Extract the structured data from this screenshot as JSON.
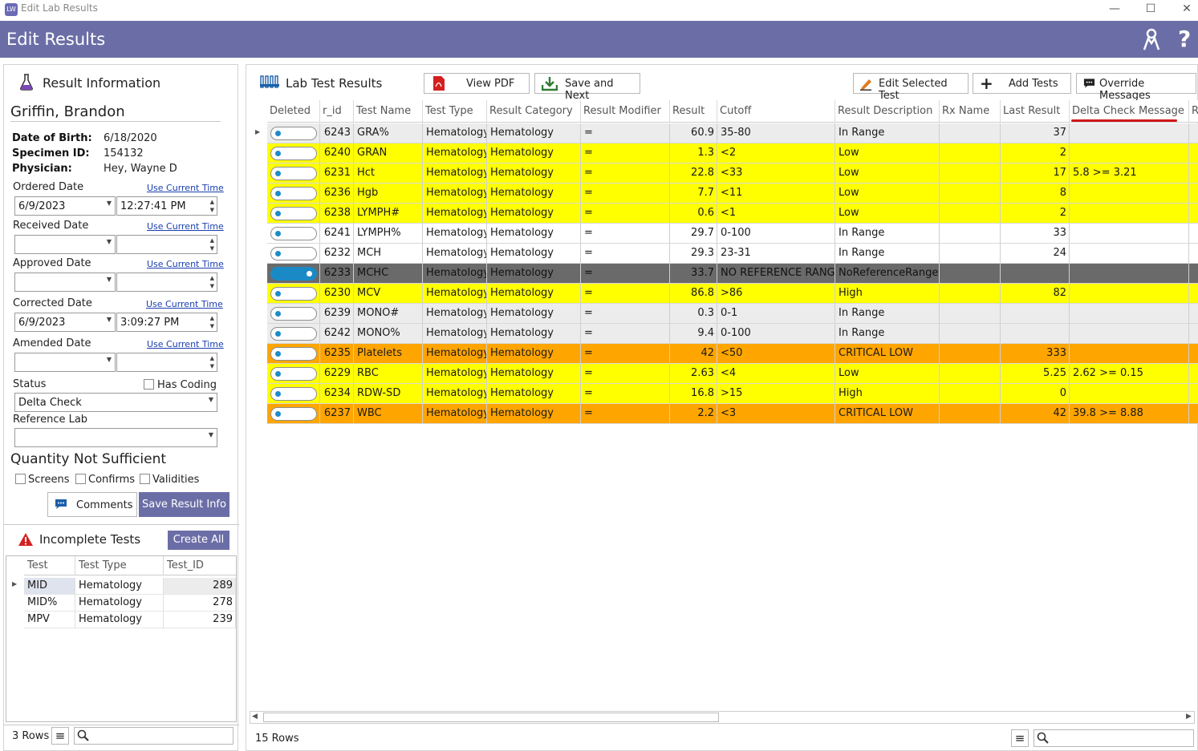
{
  "window": {
    "title": "Edit Lab Results"
  },
  "header": {
    "title": "Edit Results",
    "help": "?"
  },
  "left": {
    "section_title": "Result Information",
    "patient_name": "Griffin, Brandon",
    "dob_label": "Date of Birth:",
    "dob": "6/18/2020",
    "specimen_label": "Specimen ID:",
    "specimen": "154132",
    "physician_label": "Physician:",
    "physician": "Hey, Wayne D",
    "ordered_label": "Ordered Date",
    "ordered_date": "6/9/2023",
    "ordered_time": "12:27:41 PM",
    "received_label": "Received Date",
    "approved_label": "Approved Date",
    "corrected_label": "Corrected Date",
    "corrected_date": "6/9/2023",
    "corrected_time": "3:09:27 PM",
    "amended_label": "Amended Date",
    "use_current": "Use Current Time",
    "status_label": "Status",
    "has_coding": "Has Coding",
    "status": "Delta Check",
    "reference_lab_label": "Reference Lab",
    "qns_title": "Quantity Not Sufficient",
    "screens": "Screens",
    "confirms": "Confirms",
    "validities": "Validities",
    "comments_btn": "Comments",
    "save_btn": "Save Result Info",
    "incomplete_title": "Incomplete Tests",
    "create_all": "Create All",
    "inc_cols": [
      "Test",
      "Test Type",
      "Test_ID"
    ],
    "inc_rows": [
      [
        "MID",
        "Hematology",
        "289"
      ],
      [
        "MID%",
        "Hematology",
        "278"
      ],
      [
        "MPV",
        "Hematology",
        "239"
      ]
    ],
    "rows_count": "3 Rows"
  },
  "right": {
    "title": "Lab Test Results",
    "view_pdf": "View PDF",
    "save_next": "Save and Next",
    "edit_selected": "Edit Selected Test",
    "add_tests": "Add Tests",
    "override": "Override Messages",
    "columns": [
      "Deleted",
      "r_id",
      "Test Name",
      "Test Type",
      "Result Category",
      "Result Modifier",
      "Result",
      "Cutoff",
      "Result Description",
      "Rx Name",
      "Last Result",
      "Delta Check Message",
      "R"
    ],
    "rows": [
      {
        "on": false,
        "color": "#ececec",
        "cells": [
          "6243",
          "GRA%",
          "Hematology",
          "Hematology",
          "=",
          "60.9",
          "35-80",
          "In Range",
          "",
          "37",
          ""
        ]
      },
      {
        "on": false,
        "color": "#ffff00",
        "cells": [
          "6240",
          "GRAN",
          "Hematology",
          "Hematology",
          "=",
          "1.3",
          "<2",
          "Low",
          "",
          "2",
          ""
        ]
      },
      {
        "on": false,
        "color": "#ffff00",
        "cells": [
          "6231",
          "Hct",
          "Hematology",
          "Hematology",
          "=",
          "22.8",
          "<33",
          "Low",
          "",
          "17",
          "5.8 >= 3.21"
        ]
      },
      {
        "on": false,
        "color": "#ffff00",
        "cells": [
          "6236",
          "Hgb",
          "Hematology",
          "Hematology",
          "=",
          "7.7",
          "<11",
          "Low",
          "",
          "8",
          ""
        ]
      },
      {
        "on": false,
        "color": "#ffff00",
        "cells": [
          "6238",
          "LYMPH#",
          "Hematology",
          "Hematology",
          "=",
          "0.6",
          "<1",
          "Low",
          "",
          "2",
          ""
        ]
      },
      {
        "on": false,
        "color": "#ffffff",
        "cells": [
          "6241",
          "LYMPH%",
          "Hematology",
          "Hematology",
          "=",
          "29.7",
          "0-100",
          "In Range",
          "",
          "33",
          ""
        ]
      },
      {
        "on": false,
        "color": "#ffffff",
        "cells": [
          "6232",
          "MCH",
          "Hematology",
          "Hematology",
          "=",
          "29.3",
          "23-31",
          "In Range",
          "",
          "24",
          ""
        ]
      },
      {
        "on": true,
        "color": "#6a6a6a",
        "cells": [
          "6233",
          "MCHC",
          "Hematology",
          "Hematology",
          "=",
          "33.7",
          "NO REFERENCE RANGE",
          "NoReferenceRange",
          "",
          "",
          ""
        ]
      },
      {
        "on": false,
        "color": "#ffff00",
        "cells": [
          "6230",
          "MCV",
          "Hematology",
          "Hematology",
          "=",
          "86.8",
          ">86",
          "High",
          "",
          "82",
          ""
        ]
      },
      {
        "on": false,
        "color": "#ececec",
        "cells": [
          "6239",
          "MONO#",
          "Hematology",
          "Hematology",
          "=",
          "0.3",
          "0-1",
          "In Range",
          "",
          "",
          ""
        ]
      },
      {
        "on": false,
        "color": "#ececec",
        "cells": [
          "6242",
          "MONO%",
          "Hematology",
          "Hematology",
          "=",
          "9.4",
          "0-100",
          "In Range",
          "",
          "",
          ""
        ]
      },
      {
        "on": false,
        "color": "#ffa500",
        "cells": [
          "6235",
          "Platelets",
          "Hematology",
          "Hematology",
          "=",
          "42",
          "<50",
          "CRITICAL LOW",
          "",
          "333",
          ""
        ]
      },
      {
        "on": false,
        "color": "#ffff00",
        "cells": [
          "6229",
          "RBC",
          "Hematology",
          "Hematology",
          "=",
          "2.63",
          "<4",
          "Low",
          "",
          "5.25",
          "2.62 >= 0.15"
        ]
      },
      {
        "on": false,
        "color": "#ffff00",
        "cells": [
          "6234",
          "RDW-SD",
          "Hematology",
          "Hematology",
          "=",
          "16.8",
          ">15",
          "High",
          "",
          "0",
          ""
        ]
      },
      {
        "on": false,
        "color": "#ffa500",
        "cells": [
          "6237",
          "WBC",
          "Hematology",
          "Hematology",
          "=",
          "2.2",
          "<3",
          "CRITICAL LOW",
          "",
          "42",
          "39.8 >= 8.88"
        ]
      }
    ],
    "rows_count": "15 Rows"
  }
}
